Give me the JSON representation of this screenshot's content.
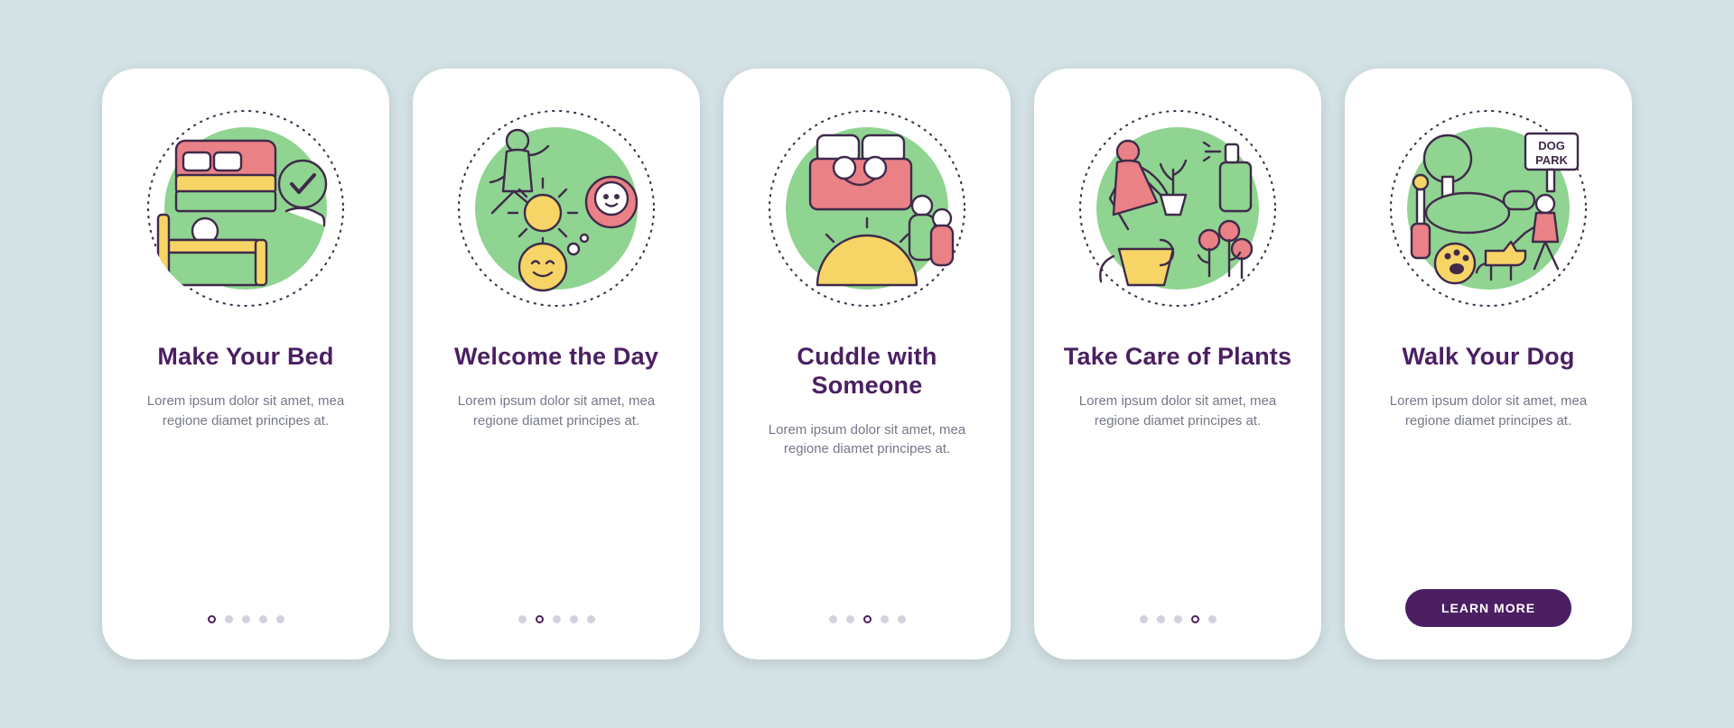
{
  "colors": {
    "accent_purple": "#4b1f62",
    "green": "#8fd491",
    "pink": "#e98186",
    "yellow": "#f6d566",
    "stroke": "#3f2a4a",
    "text_muted": "#757889",
    "dot_inactive": "#d0d3db",
    "bg": "#d3e2e5"
  },
  "cards": [
    {
      "id": "make-bed",
      "title": "Make Your Bed",
      "desc": "Lorem ipsum dolor sit amet, mea regione diamet principes at.",
      "icon": "make-bed-icon",
      "active_dot": 0
    },
    {
      "id": "welcome-day",
      "title": "Welcome the Day",
      "desc": "Lorem ipsum dolor sit amet, mea regione diamet principes at.",
      "icon": "welcome-day-icon",
      "active_dot": 1
    },
    {
      "id": "cuddle",
      "title": "Cuddle with Someone",
      "desc": "Lorem ipsum dolor sit amet, mea regione diamet principes at.",
      "icon": "cuddle-icon",
      "active_dot": 2
    },
    {
      "id": "plants",
      "title": "Take Care of Plants",
      "desc": "Lorem ipsum dolor sit amet, mea regione diamet principes at.",
      "icon": "plants-icon",
      "active_dot": 3
    },
    {
      "id": "walk-dog",
      "title": "Walk Your Dog",
      "desc": "Lorem ipsum dolor sit amet, mea regione diamet principes at.",
      "icon": "walk-dog-icon",
      "cta": "LEARN MORE",
      "sign_text": "DOG PARK"
    }
  ],
  "dot_count": 5
}
